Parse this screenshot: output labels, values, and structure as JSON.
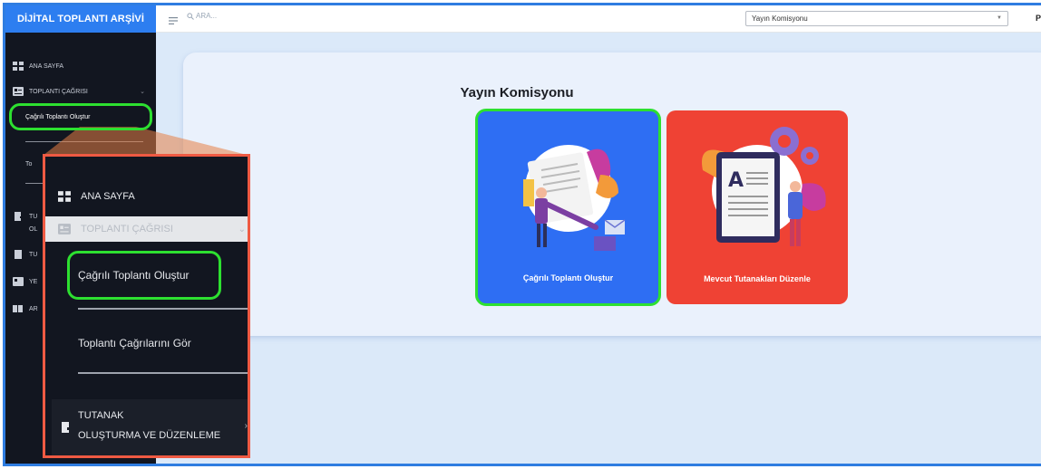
{
  "app": {
    "brand": "DİJİTAL TOPLANTI ARŞİVİ"
  },
  "topbar": {
    "search_placeholder": "ARA...",
    "committee_select": "Yayın Komisyonu",
    "profile_fragment": "Pr"
  },
  "sidebar": {
    "items": [
      {
        "label": "ANA SAYFA",
        "icon": "dashboard-icon"
      },
      {
        "label": "TOPLANTI ÇAĞRISI",
        "icon": "meeting-card-icon"
      },
      {
        "label": "Çağrılı Toplantı Oluştur"
      },
      {
        "label": "To"
      },
      {
        "label": "TU"
      },
      {
        "label": "OL"
      },
      {
        "label": "TU"
      },
      {
        "label": "YE"
      },
      {
        "label": "AR"
      }
    ]
  },
  "main": {
    "title": "Yayın Komisyonu",
    "cards": [
      {
        "label": "Çağrılı Toplantı Oluştur",
        "color": "#2e6ef3"
      },
      {
        "label": "Mevcut Tutanakları Düzenle",
        "color": "#ef4234"
      }
    ]
  },
  "zoom": {
    "items": [
      {
        "label": "ANA SAYFA"
      },
      {
        "label": "TOPLANTI ÇAĞRISI"
      },
      {
        "label": "Çağrılı Toplantı Oluştur"
      },
      {
        "label": "Toplantı Çağrılarını Gör"
      },
      {
        "label": "TUTANAK"
      },
      {
        "label": "OLUŞTURMA VE DÜZENLEME"
      }
    ]
  },
  "colors": {
    "accent": "#2d7ef0",
    "highlight": "#2de030",
    "callout": "#ef5a43"
  }
}
